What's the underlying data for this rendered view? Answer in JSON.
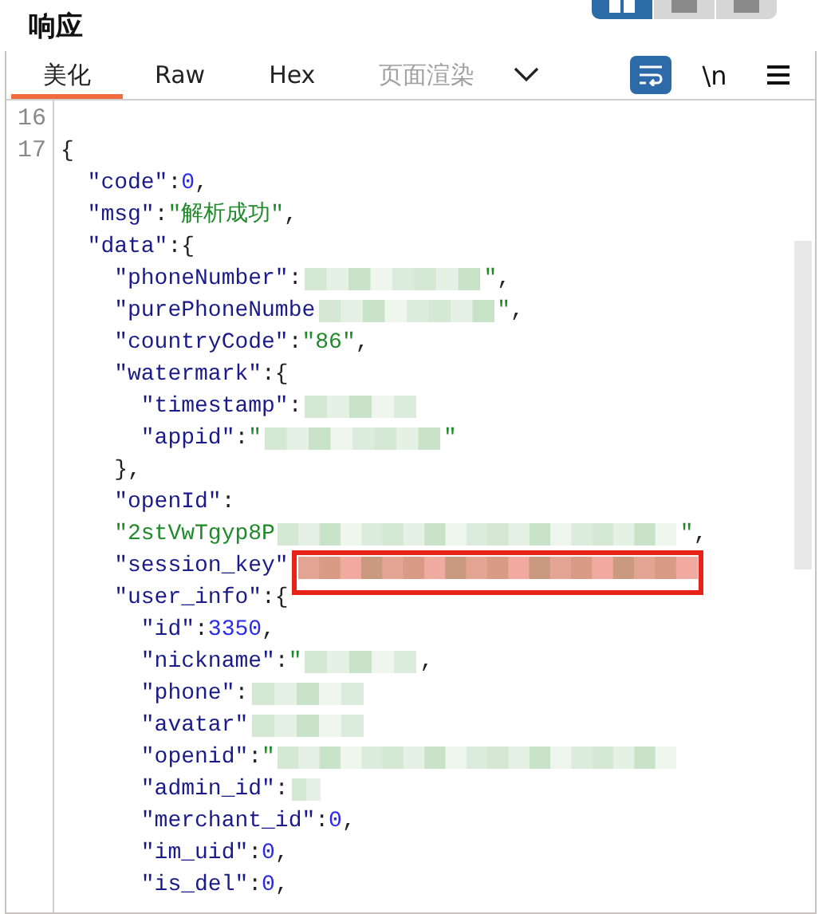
{
  "title": "响应",
  "view_toggles": [
    {
      "selected": true
    },
    {
      "selected": false
    },
    {
      "selected": false
    }
  ],
  "tabs": [
    {
      "label": "美化",
      "selected": true,
      "disabled": false
    },
    {
      "label": "Raw",
      "selected": false,
      "disabled": false
    },
    {
      "label": "Hex",
      "selected": false,
      "disabled": false
    },
    {
      "label": "页面渲染",
      "selected": false,
      "disabled": true
    }
  ],
  "tools": [
    {
      "kind": "wrap",
      "selected": true
    },
    {
      "kind": "newline",
      "text": "\\n",
      "selected": false
    },
    {
      "kind": "menu",
      "selected": false
    }
  ],
  "editor": {
    "lines": [
      {
        "number": "16"
      },
      {
        "number": "17",
        "tokens": [
          {
            "kind": "punct",
            "text": "{"
          }
        ]
      },
      {
        "tokens": [
          {
            "kind": "key",
            "text": "  \"code\""
          },
          {
            "kind": "punct",
            "text": ":"
          },
          {
            "kind": "number",
            "text": "0"
          },
          {
            "kind": "punct",
            "text": ","
          }
        ]
      },
      {
        "tokens": [
          {
            "kind": "key",
            "text": "  \"msg\""
          },
          {
            "kind": "punct",
            "text": ":"
          },
          {
            "kind": "string",
            "text": "\"解析成功\""
          },
          {
            "kind": "punct",
            "text": ","
          }
        ]
      },
      {
        "tokens": [
          {
            "kind": "key",
            "text": "  \"data\""
          },
          {
            "kind": "punct",
            "text": ":{"
          }
        ]
      },
      {
        "tokens": [
          {
            "kind": "key",
            "text": "    \"phoneNumber\""
          },
          {
            "kind": "punct",
            "text": ":"
          },
          {
            "kind": "redacted_medium"
          },
          {
            "kind": "string",
            "text": "\""
          },
          {
            "kind": "punct",
            "text": ","
          }
        ]
      },
      {
        "tokens": [
          {
            "kind": "key",
            "text": "    \"purePhoneNumbe"
          },
          {
            "kind": "redacted_medium"
          },
          {
            "kind": "string",
            "text": "\""
          },
          {
            "kind": "punct",
            "text": ","
          }
        ]
      },
      {
        "tokens": [
          {
            "kind": "key",
            "text": "    \"countryCode\""
          },
          {
            "kind": "punct",
            "text": ":"
          },
          {
            "kind": "string",
            "text": "\"86\""
          },
          {
            "kind": "punct",
            "text": ","
          }
        ]
      },
      {
        "tokens": [
          {
            "kind": "key",
            "text": "    \"watermark\""
          },
          {
            "kind": "punct",
            "text": ":{"
          }
        ]
      },
      {
        "tokens": [
          {
            "kind": "key",
            "text": "      \"timestamp\""
          },
          {
            "kind": "punct",
            "text": ":"
          },
          {
            "kind": "redacted_short"
          }
        ]
      },
      {
        "tokens": [
          {
            "kind": "key",
            "text": "      \"appid\""
          },
          {
            "kind": "punct",
            "text": ":"
          },
          {
            "kind": "string",
            "text": "\""
          },
          {
            "kind": "redacted_medium"
          },
          {
            "kind": "string",
            "text": "\""
          }
        ]
      },
      {
        "tokens": [
          {
            "kind": "punct",
            "text": "    },"
          }
        ]
      },
      {
        "tokens": [
          {
            "kind": "key",
            "text": "    \"openId\""
          },
          {
            "kind": "punct",
            "text": ":"
          }
        ]
      },
      {
        "tokens": [
          {
            "kind": "string",
            "text": "    \"2stVwTgyp8P"
          },
          {
            "kind": "redacted_long"
          },
          {
            "kind": "string",
            "text": "\""
          },
          {
            "kind": "punct",
            "text": ","
          }
        ]
      },
      {
        "tokens": [
          {
            "kind": "key",
            "text": "    \"session_key\""
          },
          {
            "kind": "redacted_long",
            "highlighted": true
          }
        ]
      },
      {
        "tokens": [
          {
            "kind": "key",
            "text": "    \"user_info\""
          },
          {
            "kind": "punct",
            "text": ":{"
          }
        ]
      },
      {
        "tokens": [
          {
            "kind": "key",
            "text": "      \"id\""
          },
          {
            "kind": "punct",
            "text": ":"
          },
          {
            "kind": "number",
            "text": "3350"
          },
          {
            "kind": "punct",
            "text": ","
          }
        ]
      },
      {
        "tokens": [
          {
            "kind": "key",
            "text": "      \"nickname\""
          },
          {
            "kind": "punct",
            "text": ":"
          },
          {
            "kind": "string",
            "text": "\""
          },
          {
            "kind": "redacted_short"
          },
          {
            "kind": "punct",
            "text": ","
          }
        ]
      },
      {
        "tokens": [
          {
            "kind": "key",
            "text": "      \"phone\""
          },
          {
            "kind": "punct",
            "text": ":"
          },
          {
            "kind": "redacted_short"
          }
        ]
      },
      {
        "tokens": [
          {
            "kind": "key",
            "text": "      \"avatar\""
          },
          {
            "kind": "redacted_short"
          }
        ]
      },
      {
        "tokens": [
          {
            "kind": "key",
            "text": "      \"openid\""
          },
          {
            "kind": "punct",
            "text": ":"
          },
          {
            "kind": "string",
            "text": "\""
          },
          {
            "kind": "redacted_long"
          }
        ]
      },
      {
        "tokens": [
          {
            "kind": "key",
            "text": "      \"admin_id\""
          },
          {
            "kind": "punct",
            "text": ":"
          },
          {
            "kind": "redacted_tiny"
          }
        ]
      },
      {
        "tokens": [
          {
            "kind": "key",
            "text": "      \"merchant_id\""
          },
          {
            "kind": "punct",
            "text": ":"
          },
          {
            "kind": "number",
            "text": "0"
          },
          {
            "kind": "punct",
            "text": ","
          }
        ]
      },
      {
        "tokens": [
          {
            "kind": "key",
            "text": "      \"im_uid\""
          },
          {
            "kind": "punct",
            "text": ":"
          },
          {
            "kind": "number",
            "text": "0"
          },
          {
            "kind": "punct",
            "text": ","
          }
        ]
      },
      {
        "tokens": [
          {
            "kind": "key",
            "text": "      \"is_del\""
          },
          {
            "kind": "punct",
            "text": ":"
          },
          {
            "kind": "number",
            "text": "0"
          },
          {
            "kind": "punct",
            "text": ","
          }
        ]
      }
    ]
  }
}
